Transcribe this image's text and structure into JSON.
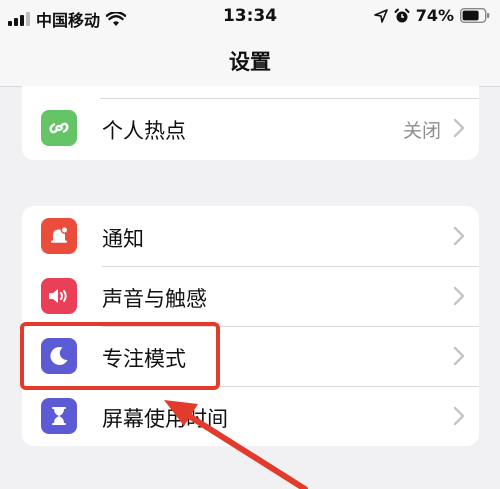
{
  "status_bar": {
    "carrier": "中国移动",
    "time": "13:34",
    "battery": "74%",
    "icons": [
      "signal-icon",
      "wifi-icon",
      "location-icon",
      "alarm-icon",
      "battery-icon"
    ]
  },
  "nav": {
    "title": "设置"
  },
  "groups": [
    {
      "items": [
        {
          "label": "个人热点",
          "value": "关闭",
          "icon": "link-icon",
          "icon_color": "#65c466"
        }
      ]
    },
    {
      "items": [
        {
          "label": "通知",
          "icon": "bell-icon",
          "icon_color": "#eb4d3d"
        },
        {
          "label": "声音与触感",
          "icon": "speaker-icon",
          "icon_color": "#e94057"
        },
        {
          "label": "专注模式",
          "icon": "moon-icon",
          "icon_color": "#5b5bd6"
        },
        {
          "label": "屏幕使用时间",
          "icon": "hourglass-icon",
          "icon_color": "#5b5bd6"
        }
      ]
    }
  ],
  "annotation": {
    "highlight_color": "#e23a2b",
    "arrow_color": "#e23a2b"
  }
}
